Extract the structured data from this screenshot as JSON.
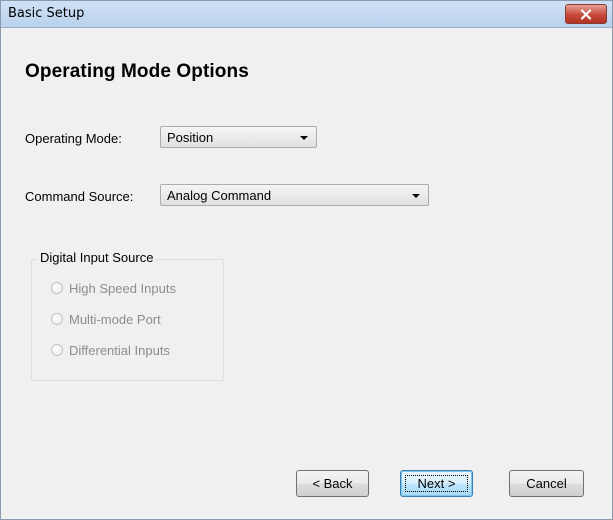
{
  "window": {
    "title": "Basic Setup"
  },
  "page": {
    "heading": "Operating Mode Options"
  },
  "operating_mode": {
    "label": "Operating Mode:",
    "selected": "Position"
  },
  "command_source": {
    "label": "Command Source:",
    "selected": "Analog Command"
  },
  "digital_input_source": {
    "legend": "Digital Input Source",
    "options": [
      {
        "label": "High Speed Inputs",
        "checked": false,
        "enabled": false
      },
      {
        "label": "Multi-mode Port",
        "checked": false,
        "enabled": false
      },
      {
        "label": "Differential Inputs",
        "checked": false,
        "enabled": false
      }
    ]
  },
  "buttons": {
    "back": "< Back",
    "next": "Next >",
    "cancel": "Cancel"
  },
  "icons": {
    "close": "close-icon",
    "dropdown": "chevron-down-icon"
  },
  "colors": {
    "titlebar": "#cfe1f5",
    "close_button": "#c74a3c",
    "dialog_background": "#f0f0f0",
    "primary_button": "#bee6fd"
  }
}
